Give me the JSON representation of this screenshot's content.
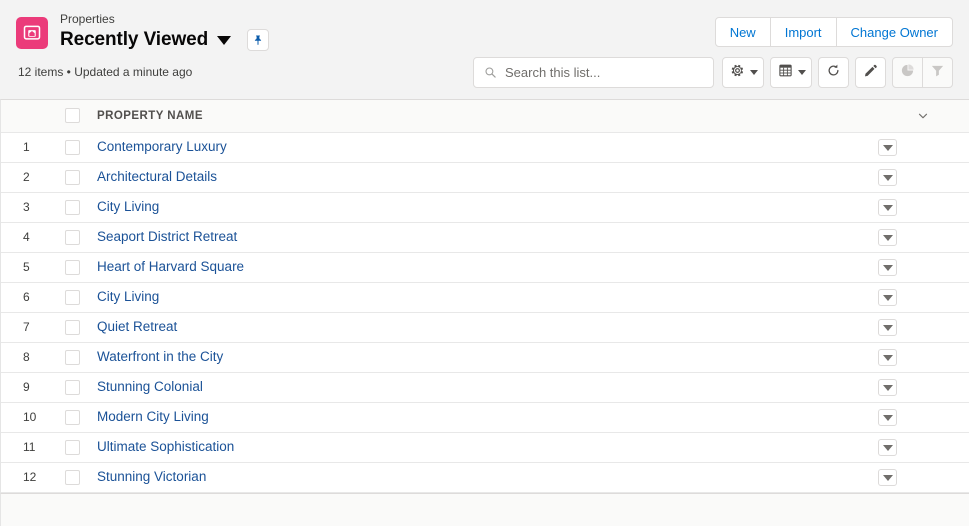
{
  "header": {
    "object_name": "Properties",
    "list_view_title": "Recently Viewed",
    "app_icon_name": "property-icon",
    "app_icon_color": "#eb3b7a",
    "view_caret_name": "list-view-chevron-down-icon",
    "pin_icon_name": "pin-icon",
    "pin_icon_color": "#0b5cab",
    "meta_text": "12 items • Updated a minute ago",
    "actions": [
      {
        "label": "New",
        "name": "new-button"
      },
      {
        "label": "Import",
        "name": "import-button"
      },
      {
        "label": "Change Owner",
        "name": "change-owner-button"
      }
    ]
  },
  "search": {
    "placeholder": "Search this list...",
    "value": "",
    "icon_name": "search-icon"
  },
  "toolbar": {
    "buttons": [
      {
        "name": "list-view-controls-button",
        "icon": "gear-icon",
        "has_caret": true,
        "disabled": false,
        "grouped": false
      },
      {
        "name": "display-as-button",
        "icon": "table-icon",
        "has_caret": true,
        "disabled": false,
        "grouped": false
      },
      {
        "name": "refresh-button",
        "icon": "refresh-icon",
        "has_caret": false,
        "disabled": false,
        "grouped": false
      },
      {
        "name": "edit-button",
        "icon": "pencil-icon",
        "has_caret": false,
        "disabled": false,
        "grouped": false
      },
      {
        "name": "charts-button",
        "icon": "chart-icon",
        "has_caret": false,
        "disabled": true,
        "grouped": true
      },
      {
        "name": "filter-button",
        "icon": "filter-icon",
        "has_caret": false,
        "disabled": true,
        "grouped": true
      }
    ]
  },
  "table": {
    "select_all_name": "select-all-checkbox",
    "column_header": "PROPERTY NAME",
    "column_actions_icon": "chevron-down-icon",
    "rows": [
      {
        "num": "1",
        "name": "Contemporary Luxury"
      },
      {
        "num": "2",
        "name": "Architectural Details"
      },
      {
        "num": "3",
        "name": "City Living"
      },
      {
        "num": "4",
        "name": "Seaport District Retreat"
      },
      {
        "num": "5",
        "name": "Heart of Harvard Square"
      },
      {
        "num": "6",
        "name": "City Living"
      },
      {
        "num": "7",
        "name": "Quiet Retreat"
      },
      {
        "num": "8",
        "name": "Waterfront in the City"
      },
      {
        "num": "9",
        "name": "Stunning Colonial"
      },
      {
        "num": "10",
        "name": "Modern City Living"
      },
      {
        "num": "11",
        "name": "Ultimate Sophistication"
      },
      {
        "num": "12",
        "name": "Stunning Victorian"
      }
    ]
  },
  "colors": {
    "brand_blue": "#0176d3",
    "link_blue": "#1b5297",
    "icon_pink": "#eb3b7a",
    "page_bg": "#f3f3f3",
    "border": "#dddbda"
  }
}
